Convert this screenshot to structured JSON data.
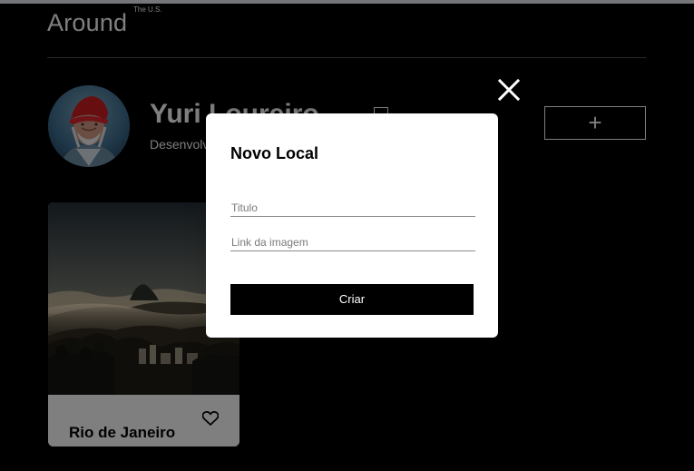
{
  "header": {
    "logo": "Around",
    "logo_superscript": "The U.S."
  },
  "profile": {
    "name": "Yuri Loureiro",
    "job": "Desenvolvedor"
  },
  "profile_actions": {
    "edit_icon": "edit-icon",
    "add_symbol": "+"
  },
  "cards": [
    {
      "title": "Rio de Janeiro",
      "icon": "heart-outline-icon"
    }
  ],
  "popup": {
    "title": "Novo Local",
    "title_input": {
      "placeholder": "Titulo",
      "value": ""
    },
    "link_input": {
      "placeholder": "Link da imagem",
      "value": ""
    },
    "submit_label": "Criar",
    "close_icon": "close-icon"
  },
  "colors": {
    "page_background": "#000000",
    "overlay": "rgba(0,0,0,0.5)",
    "popup_background": "#ffffff",
    "button_background": "#000000",
    "text_primary": "#ffffff"
  }
}
